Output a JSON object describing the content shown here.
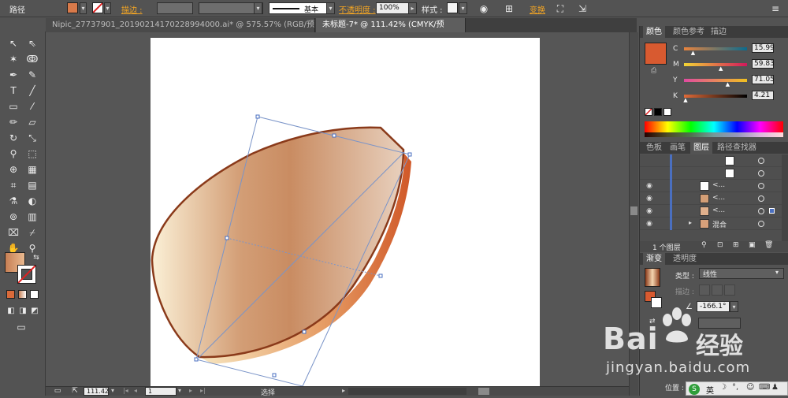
{
  "control_bar": {
    "title": "路径",
    "stroke_label": "描边 :",
    "stroke_style_label": "基本",
    "opacity_label": "不透明度 :",
    "opacity_value": "100%",
    "style_label": "样式 :",
    "transform_label": "变换",
    "fill_color": "#d97a4a",
    "stroke_color": "#ffffff"
  },
  "tabs": [
    {
      "label": "Nipic_27737901_20190214170228994000.ai* @ 575.57% (RGB/预览)",
      "active": false
    },
    {
      "label": "未标题-7* @ 111.42% (CMYK/预览)",
      "active": true
    }
  ],
  "color_panel": {
    "tabs": [
      "颜色",
      "颜色参考",
      "描边"
    ],
    "swatch": "#d85a30",
    "channels": [
      {
        "name": "C",
        "value": "15.99",
        "level": 0.16
      },
      {
        "name": "M",
        "value": "59.83",
        "level": 0.6
      },
      {
        "name": "Y",
        "value": "71.05",
        "level": 0.71
      },
      {
        "name": "K",
        "value": "4.21",
        "level": 0.04
      }
    ]
  },
  "layers_panel": {
    "tabs": [
      "色板",
      "画笔",
      "图层",
      "路径查找器"
    ],
    "rows": [
      {
        "name": "",
        "eye": false
      },
      {
        "name": "",
        "eye": false
      },
      {
        "name": "<...",
        "eye": true
      },
      {
        "name": "<...",
        "eye": true
      },
      {
        "name": "<...",
        "eye": true
      },
      {
        "name": "混合",
        "eye": true
      }
    ],
    "footer": "1 个图层"
  },
  "gradient_panel": {
    "tabs": [
      "渐变",
      "透明度"
    ],
    "type_label": "类型 :",
    "type_value": "线性",
    "stroke_label": "描边 :",
    "angle_value": "-166.1°",
    "position_label": "位置 :"
  },
  "status_bar": {
    "zoom": "111.42",
    "page": "1",
    "tool": "选择"
  },
  "watermark": {
    "brand": "Bai",
    "brand2": "经验",
    "url": "jingyan.baidu.com"
  },
  "taskbar": {
    "lang": "英"
  }
}
